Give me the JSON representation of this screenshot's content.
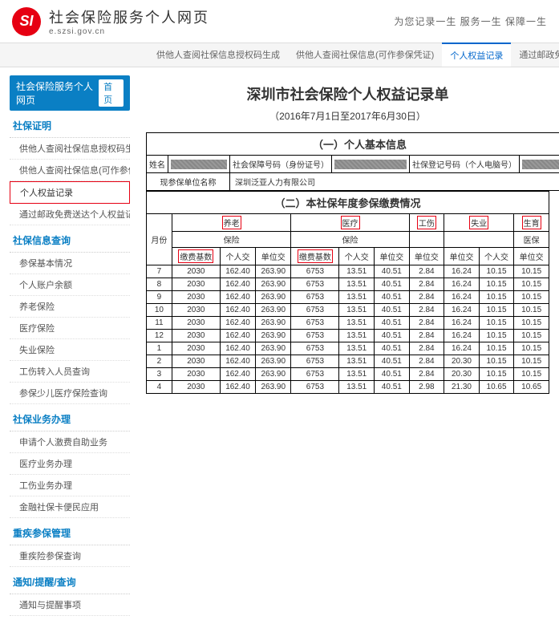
{
  "header": {
    "logo_text": "SI",
    "title": "社会保险服务个人网页",
    "subtitle": "e.szsi.gov.cn",
    "slogan": "为您记录一生 服务一生 保障一生"
  },
  "topnav": {
    "items": [
      {
        "label": "供他人查阅社保信息授权码生成",
        "active": false
      },
      {
        "label": "供他人查阅社保信息(可作参保凭证)",
        "active": false
      },
      {
        "label": "个人权益记录",
        "active": true
      },
      {
        "label": "通过邮政免费送达个人权益记录单",
        "active": false
      }
    ]
  },
  "sidebar": {
    "head": "社会保险服务个人网页",
    "home": "首页",
    "groups": [
      {
        "title": "社保证明",
        "items": [
          {
            "label": "供他人查阅社保信息授权码生成"
          },
          {
            "label": "供他人查阅社保信息(可作参保凭证)"
          },
          {
            "label": "个人权益记录",
            "hl": true
          },
          {
            "label": "通过邮政免费送达个人权益记录单"
          }
        ]
      },
      {
        "title": "社保信息查询",
        "items": [
          {
            "label": "参保基本情况"
          },
          {
            "label": "个人账户余额"
          },
          {
            "label": "养老保险"
          },
          {
            "label": "医疗保险"
          },
          {
            "label": "失业保险"
          },
          {
            "label": "工伤转入人员查询"
          },
          {
            "label": "参保少儿医疗保险查询"
          }
        ]
      },
      {
        "title": "社保业务办理",
        "items": [
          {
            "label": "申请个人激费自助业务"
          },
          {
            "label": "医疗业务办理"
          },
          {
            "label": "工伤业务办理"
          },
          {
            "label": "金融社保卡便民应用"
          }
        ]
      },
      {
        "title": "重疾参保管理",
        "items": [
          {
            "label": "重疾险参保查询"
          }
        ]
      },
      {
        "title": "通知/提醒/查询",
        "items": [
          {
            "label": "通知与提醒事项"
          }
        ]
      }
    ]
  },
  "doc": {
    "title": "深圳市社会保险个人权益记录单",
    "period": "（2016年7月1日至2017年6月30日）",
    "section1": "（一）个人基本信息",
    "section2": "（二）本社保年度参保缴费情况",
    "info_labels": {
      "name": "姓名",
      "ssn": "社会保障号码（身份证号）",
      "reg": "社保登记号码（个人电脑号）",
      "employer_label": "现参保单位名称",
      "employer": "深圳泛亚人力有限公司"
    },
    "cat_header": "月份",
    "categories": [
      "养老",
      "医疗",
      "工伤",
      "失业",
      "生育"
    ],
    "sub1": [
      "保险",
      "保险",
      "",
      "",
      "医保"
    ],
    "cols": [
      "缴费基数",
      "个人交",
      "单位交",
      "缴费基数",
      "个人交",
      "单位交",
      "单位交",
      "单位交",
      "个人交",
      "单位交"
    ]
  },
  "chart_data": {
    "type": "table",
    "columns": [
      "月份",
      "养老缴费基数",
      "养老个人交",
      "养老单位交",
      "医疗缴费基数",
      "医疗个人交",
      "医疗单位交",
      "工伤单位交",
      "失业单位交",
      "失业个人交",
      "生育单位交"
    ],
    "rows": [
      [
        7,
        2030,
        162.4,
        263.9,
        6753,
        13.51,
        40.51,
        2.84,
        16.24,
        10.15,
        10.15
      ],
      [
        8,
        2030,
        162.4,
        263.9,
        6753,
        13.51,
        40.51,
        2.84,
        16.24,
        10.15,
        10.15
      ],
      [
        9,
        2030,
        162.4,
        263.9,
        6753,
        13.51,
        40.51,
        2.84,
        16.24,
        10.15,
        10.15
      ],
      [
        10,
        2030,
        162.4,
        263.9,
        6753,
        13.51,
        40.51,
        2.84,
        16.24,
        10.15,
        10.15
      ],
      [
        11,
        2030,
        162.4,
        263.9,
        6753,
        13.51,
        40.51,
        2.84,
        16.24,
        10.15,
        10.15
      ],
      [
        12,
        2030,
        162.4,
        263.9,
        6753,
        13.51,
        40.51,
        2.84,
        16.24,
        10.15,
        10.15
      ],
      [
        1,
        2030,
        162.4,
        263.9,
        6753,
        13.51,
        40.51,
        2.84,
        16.24,
        10.15,
        10.15
      ],
      [
        2,
        2030,
        162.4,
        263.9,
        6753,
        13.51,
        40.51,
        2.84,
        20.3,
        10.15,
        10.15
      ],
      [
        3,
        2030,
        162.4,
        263.9,
        6753,
        13.51,
        40.51,
        2.84,
        20.3,
        10.15,
        10.15
      ],
      [
        4,
        2030,
        162.4,
        263.9,
        6753,
        13.51,
        40.51,
        2.98,
        21.3,
        10.65,
        10.65
      ]
    ]
  }
}
